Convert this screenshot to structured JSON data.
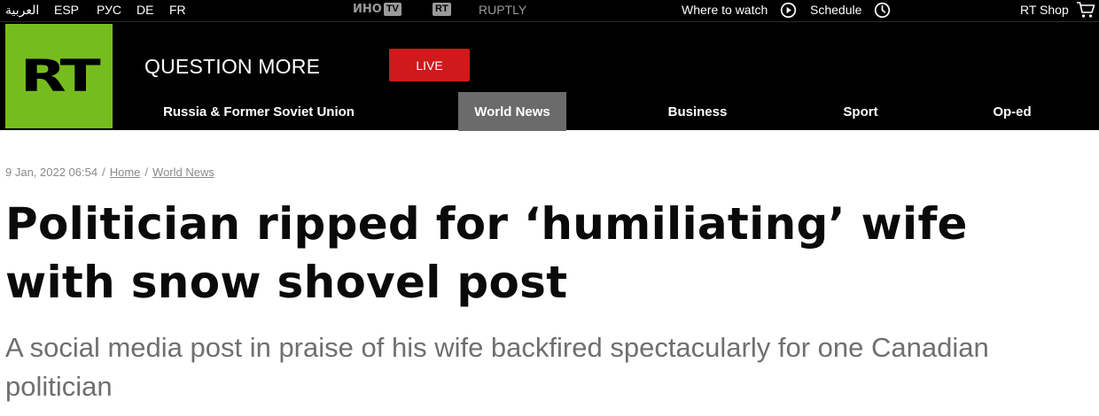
{
  "topbar": {
    "languages": [
      "العربية",
      "ESP",
      "РУС",
      "DE",
      "FR"
    ],
    "partner_ino": "ИНО",
    "partner_ino_box": "TV",
    "partner_rt_box": "RT",
    "partner_ruptly": "RUPTLY",
    "where_to_watch": "Where to watch",
    "schedule": "Schedule",
    "shop": "RT Shop"
  },
  "header": {
    "logo_text": "RT",
    "tagline": "QUESTION MORE",
    "live_label": "LIVE",
    "nav": [
      "Russia & Former Soviet Union",
      "World News",
      "Business",
      "Sport",
      "Op-ed"
    ],
    "active_nav": "World News",
    "brand_color": "#77bc1f",
    "live_color": "#d0191a"
  },
  "article": {
    "date": "9 Jan, 2022 06:54",
    "breadcrumb": [
      "Home",
      "World News"
    ],
    "title": "Politician ripped for ‘humiliating’ wife with snow shovel post",
    "summary": "A social media post in praise of his wife backfired spectacularly for one Canadian politician"
  }
}
